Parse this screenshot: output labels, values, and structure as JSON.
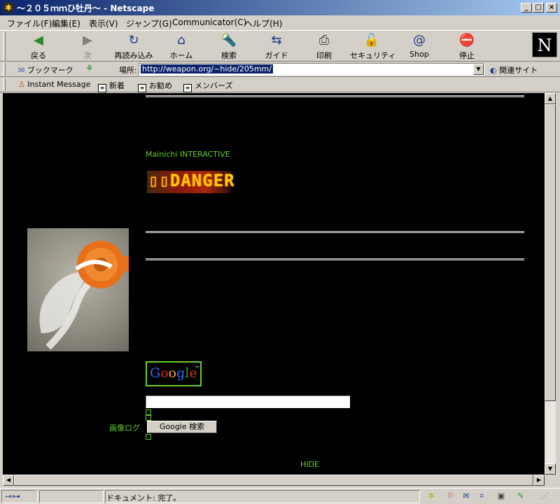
{
  "window": {
    "title": "～２０５ｍｍひ牡丹～ - Netscape",
    "minimize": "_",
    "maximize": "□",
    "close": "×"
  },
  "menu": [
    "ファイル(F)",
    "編集(E)",
    "表示(V)",
    "ジャンプ(G)",
    "Communicator(C)",
    "ヘルプ(H)"
  ],
  "toolbar": {
    "back": "戻る",
    "forward": "次",
    "reload": "再読み込み",
    "home": "ホーム",
    "search": "検索",
    "guide": "ガイド",
    "print": "印刷",
    "security": "セキュリティ",
    "shop": "Shop",
    "stop": "停止",
    "logo": "N"
  },
  "location": {
    "bookmarks": "ブックマーク",
    "label": "場所:",
    "url": "http://weapon.org/~hide/205mm/",
    "related": "関連サイト"
  },
  "personal": {
    "instant_message": "Instant Message",
    "new": "新着",
    "recommended": "お勧め",
    "members": "メンバーズ"
  },
  "page": {
    "mainichi": "Mainichi INTERACTIVE",
    "danger_banner": "▯▯DANGER",
    "google_logo": "Google",
    "search_button": "Google 検索",
    "image_log": "画像ログ",
    "footer": "HIDE"
  },
  "status": {
    "text": "ドキュメント: 完了。"
  },
  "colors": {
    "page_bg": "#000000",
    "page_text": "#66cc33",
    "chrome_bg": "#d4d0c8",
    "titlebar": "#0a246a"
  }
}
